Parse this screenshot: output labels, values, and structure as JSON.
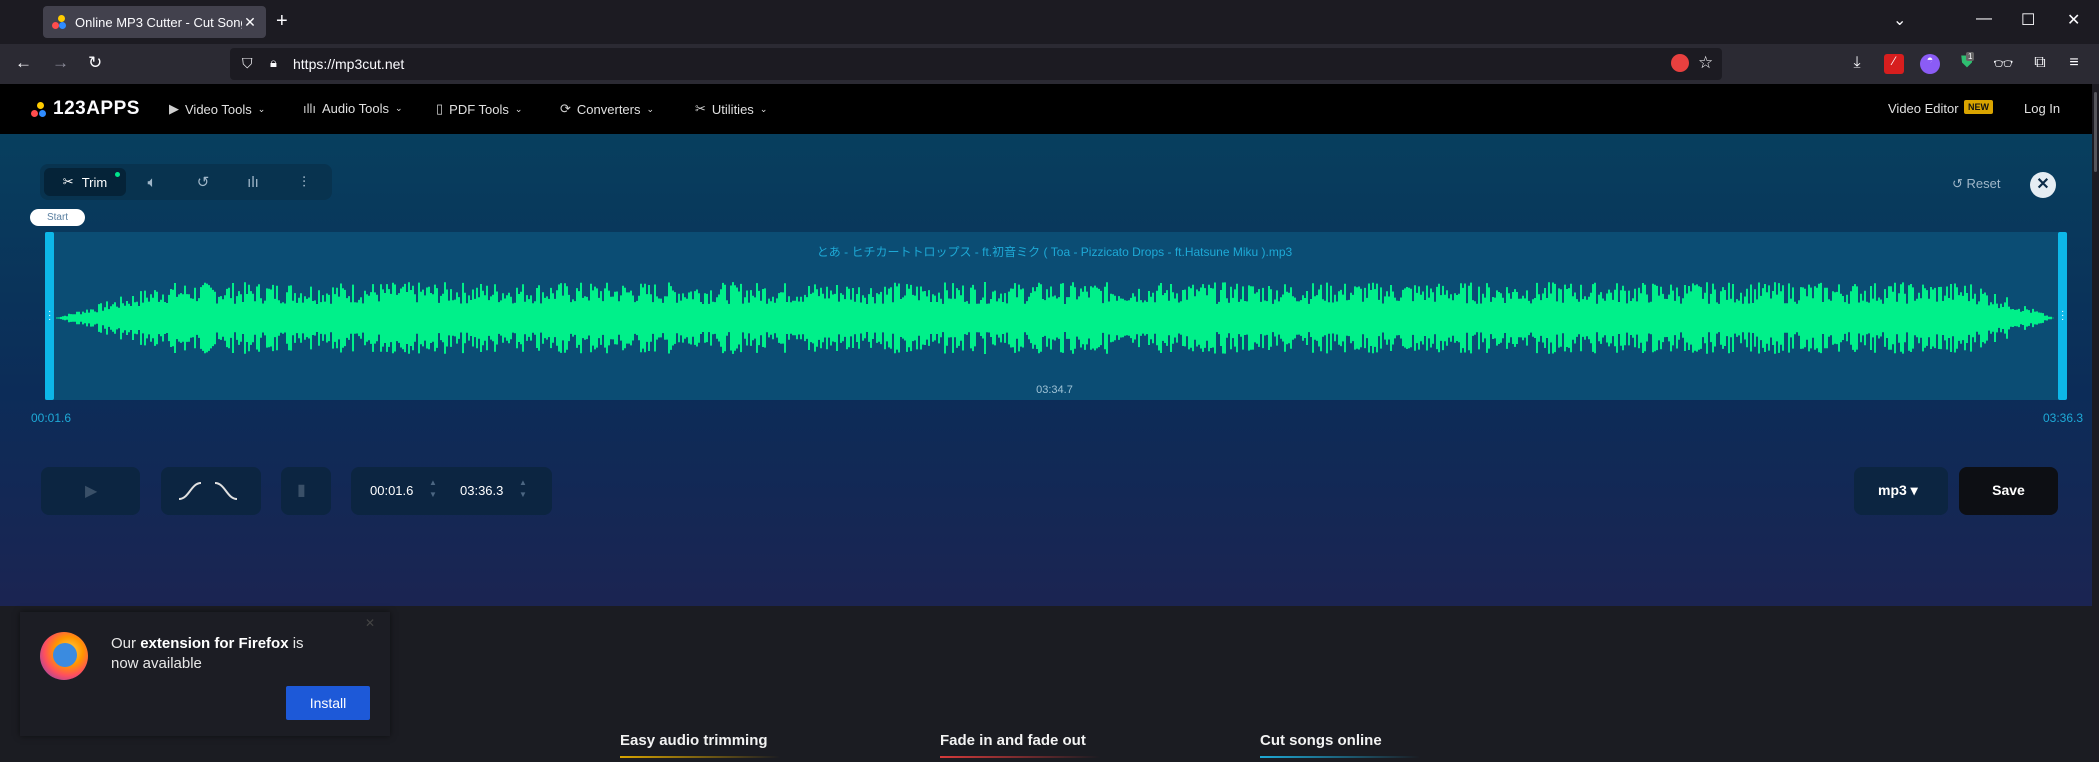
{
  "browser": {
    "tab_title": "Online MP3 Cutter - Cut Songs",
    "tab_close": "✕",
    "new_tab": "+",
    "url": "https://mp3cut.net",
    "win_min": "—",
    "win_max": "☐",
    "win_close": "✕",
    "dropdown": "⌄",
    "ext_badge": "1"
  },
  "site": {
    "logo": "123APPS",
    "menu": [
      {
        "label": "Video Tools",
        "icon": "video-icon"
      },
      {
        "label": "Audio Tools",
        "icon": "audio-icon"
      },
      {
        "label": "PDF Tools",
        "icon": "pdf-icon"
      },
      {
        "label": "Converters",
        "icon": "converters-icon"
      },
      {
        "label": "Utilities",
        "icon": "utilities-icon"
      }
    ],
    "video_editor": "Video Editor",
    "new_badge": "NEW",
    "login": "Log In"
  },
  "editor": {
    "trim_label": "Trim",
    "reset_label": "Reset",
    "start_tag": "Start",
    "file_name": "とあ - ヒチカートトロップス - ft.初音ミク ( Toa - Pizzicato Drops - ft.Hatsune Miku ).mp3",
    "duration": "03:34.7",
    "start_label": "00:01.6",
    "end_label": "03:36.3",
    "start_time": "00:01.6",
    "end_time": "03:36.3",
    "format": "mp3 ▾",
    "save_label": "Save",
    "waveform_color": "#00f08a"
  },
  "popup": {
    "msg_prefix": "Our ",
    "msg_bold": "extension for Firefox",
    "msg_suffix": " is now available",
    "close": "✕",
    "install_label": "Install"
  },
  "features": [
    {
      "label": "Easy audio trimming",
      "color": "#d9a400"
    },
    {
      "label": "Fade in and fade out",
      "color": "#d63a3a"
    },
    {
      "label": "Cut songs online",
      "color": "#1ea9d6"
    }
  ]
}
